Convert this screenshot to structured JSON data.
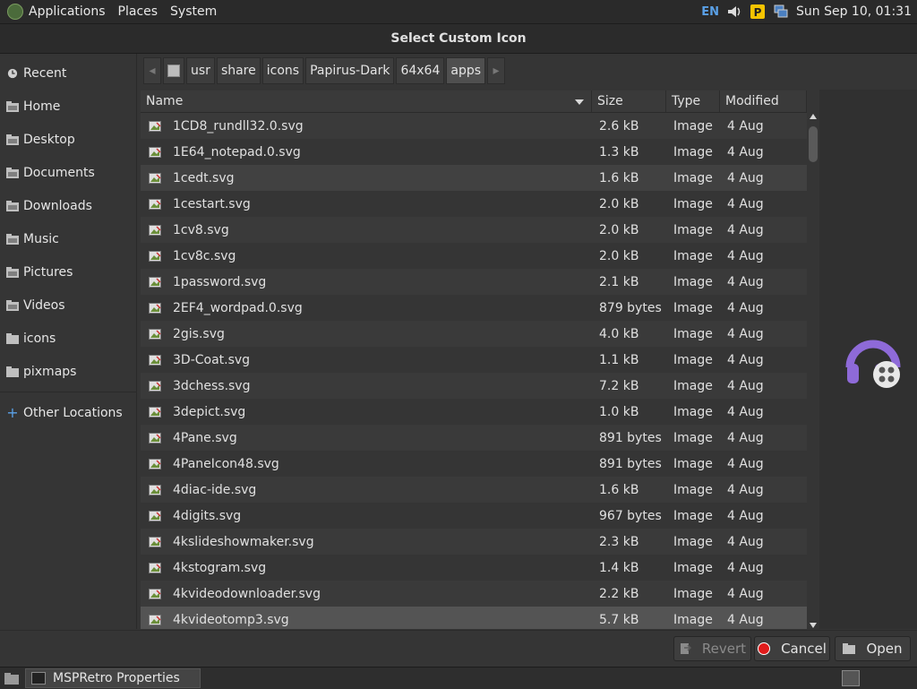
{
  "topbar": {
    "menus": [
      "Applications",
      "Places",
      "System"
    ],
    "language": "EN",
    "clock": "Sun Sep 10, 01:31"
  },
  "dialog": {
    "title": "Select Custom Icon"
  },
  "sidebar": {
    "items": [
      {
        "label": "Recent",
        "icon": "recent-icon"
      },
      {
        "label": "Home",
        "icon": "folder-icon"
      },
      {
        "label": "Desktop",
        "icon": "folder-icon"
      },
      {
        "label": "Documents",
        "icon": "folder-icon"
      },
      {
        "label": "Downloads",
        "icon": "folder-icon"
      },
      {
        "label": "Music",
        "icon": "folder-icon"
      },
      {
        "label": "Pictures",
        "icon": "folder-icon"
      },
      {
        "label": "Videos",
        "icon": "folder-icon"
      },
      {
        "label": "icons",
        "icon": "folder-icon"
      },
      {
        "label": "pixmaps",
        "icon": "folder-icon"
      }
    ],
    "other_locations": "Other Locations"
  },
  "path": {
    "crumbs": [
      "usr",
      "share",
      "icons",
      "Papirus-Dark",
      "64x64",
      "apps"
    ],
    "active": "apps"
  },
  "columns": {
    "name": "Name",
    "size": "Size",
    "type": "Type",
    "modified": "Modified"
  },
  "files": [
    {
      "name": "1CD8_rundll32.0.svg",
      "size": "2.6 kB",
      "type": "Image",
      "modified": "4 Aug"
    },
    {
      "name": "1E64_notepad.0.svg",
      "size": "1.3 kB",
      "type": "Image",
      "modified": "4 Aug"
    },
    {
      "name": "1cedt.svg",
      "size": "1.6 kB",
      "type": "Image",
      "modified": "4 Aug"
    },
    {
      "name": "1cestart.svg",
      "size": "2.0 kB",
      "type": "Image",
      "modified": "4 Aug"
    },
    {
      "name": "1cv8.svg",
      "size": "2.0 kB",
      "type": "Image",
      "modified": "4 Aug"
    },
    {
      "name": "1cv8c.svg",
      "size": "2.0 kB",
      "type": "Image",
      "modified": "4 Aug"
    },
    {
      "name": "1password.svg",
      "size": "2.1 kB",
      "type": "Image",
      "modified": "4 Aug"
    },
    {
      "name": "2EF4_wordpad.0.svg",
      "size": "879 bytes",
      "type": "Image",
      "modified": "4 Aug"
    },
    {
      "name": "2gis.svg",
      "size": "4.0 kB",
      "type": "Image",
      "modified": "4 Aug"
    },
    {
      "name": "3D-Coat.svg",
      "size": "1.1 kB",
      "type": "Image",
      "modified": "4 Aug"
    },
    {
      "name": "3dchess.svg",
      "size": "7.2 kB",
      "type": "Image",
      "modified": "4 Aug"
    },
    {
      "name": "3depict.svg",
      "size": "1.0 kB",
      "type": "Image",
      "modified": "4 Aug"
    },
    {
      "name": "4Pane.svg",
      "size": "891 bytes",
      "type": "Image",
      "modified": "4 Aug"
    },
    {
      "name": "4PaneIcon48.svg",
      "size": "891 bytes",
      "type": "Image",
      "modified": "4 Aug"
    },
    {
      "name": "4diac-ide.svg",
      "size": "1.6 kB",
      "type": "Image",
      "modified": "4 Aug"
    },
    {
      "name": "4digits.svg",
      "size": "967 bytes",
      "type": "Image",
      "modified": "4 Aug"
    },
    {
      "name": "4kslideshowmaker.svg",
      "size": "2.3 kB",
      "type": "Image",
      "modified": "4 Aug"
    },
    {
      "name": "4kstogram.svg",
      "size": "1.4 kB",
      "type": "Image",
      "modified": "4 Aug"
    },
    {
      "name": "4kvideodownloader.svg",
      "size": "2.2 kB",
      "type": "Image",
      "modified": "4 Aug"
    },
    {
      "name": "4kvideotomp3.svg",
      "size": "5.7 kB",
      "type": "Image",
      "modified": "4 Aug"
    }
  ],
  "selected_index": 19,
  "hover_index": 2,
  "buttons": {
    "revert": "Revert",
    "cancel": "Cancel",
    "open": "Open"
  },
  "taskbar": {
    "window": "MSPRetro Properties"
  },
  "colors": {
    "accent_blue": "#5aa0e6",
    "preview_purple": "#8e6ad8",
    "record_red": "#e01b1b"
  }
}
